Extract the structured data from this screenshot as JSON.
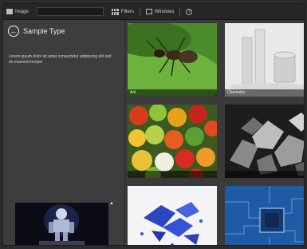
{
  "toolbar": {
    "home_label": "Image",
    "search_placeholder": "",
    "filter_label": "Filters",
    "view_label": "Windows",
    "help_label": "?"
  },
  "left_panel": {
    "title": "Sample Type",
    "description": "Lorem ipsum dolor sit amet consectetur adipiscing elit sed do eiusmod tempor"
  },
  "tiles": [
    {
      "label": "Ant"
    },
    {
      "label": "Chemistry"
    },
    {
      "label": ""
    },
    {
      "label": ""
    },
    {
      "label": ""
    },
    {
      "label": ""
    }
  ],
  "colors": {
    "panel": "#3d3d3d",
    "toolbar": "#262626",
    "leaf_green": "#5fa235",
    "chip_blue": "#2b6fb3"
  }
}
